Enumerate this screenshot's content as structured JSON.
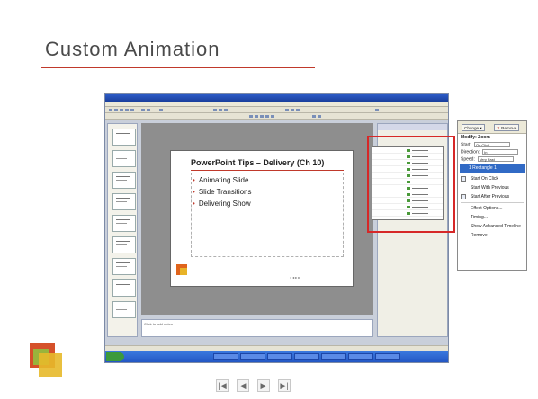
{
  "slide_title": "Custom Animation",
  "screenshot": {
    "slide_heading": "PowerPoint Tips – Delivery (Ch 10)",
    "bullets": [
      "Animating Slide",
      "Slide Transitions",
      "Delivering Show"
    ],
    "notes_placeholder": "Click to add notes"
  },
  "context_panel": {
    "change_button": "Change",
    "remove_button": "Remove",
    "modify_label": "Modify: Zoom",
    "fields": [
      {
        "label": "Start:",
        "value": "On Click"
      },
      {
        "label": "Direction:",
        "value": "In"
      },
      {
        "label": "Speed:",
        "value": "Very Fast"
      }
    ],
    "selected_item": "1  Rectangle 1",
    "menu_items": [
      "Start On Click",
      "Start With Previous",
      "Start After Previous",
      "Effect Options...",
      "Timing...",
      "Show Advanced Timeline",
      "Remove"
    ]
  },
  "navigation": {
    "first": "|◀",
    "prev": "◀",
    "next": "▶",
    "last": "▶|"
  },
  "colors": {
    "accent": "#c0392b",
    "highlight_box": "#d62828"
  }
}
